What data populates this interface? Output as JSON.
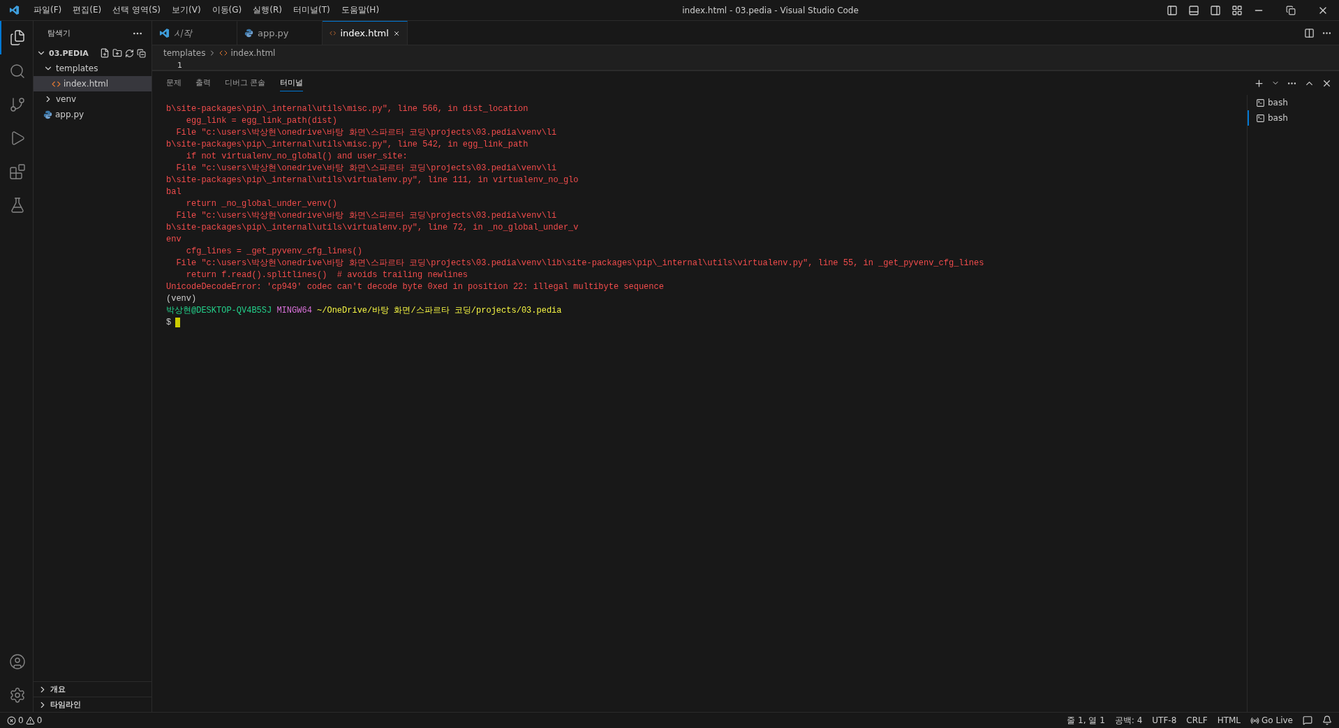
{
  "menu": [
    "파일(F)",
    "편집(E)",
    "선택 영역(S)",
    "보기(V)",
    "이동(G)",
    "실행(R)",
    "터미널(T)",
    "도움말(H)"
  ],
  "window": {
    "title": "index.html - 03.pedia - Visual Studio Code"
  },
  "activity_items": [
    {
      "kind": "explorer",
      "selected": true
    },
    {
      "kind": "search",
      "selected": false
    },
    {
      "kind": "scm",
      "selected": false
    },
    {
      "kind": "run",
      "selected": false
    },
    {
      "kind": "extensions",
      "selected": false
    },
    {
      "kind": "testing",
      "selected": false
    }
  ],
  "sidebar": {
    "title": "탐색기",
    "folder": {
      "name": "03.PEDIA",
      "expanded": true
    },
    "tree": [
      {
        "name": "templates",
        "kind": "folder",
        "expanded": true,
        "selected": false,
        "children": [
          {
            "name": "index.html",
            "kind": "html",
            "selected": true
          }
        ]
      },
      {
        "name": "venv",
        "kind": "folder",
        "expanded": false,
        "selected": false
      },
      {
        "name": "app.py",
        "kind": "python",
        "selected": false
      }
    ],
    "sections": [
      {
        "title": "개요",
        "expanded": false
      },
      {
        "title": "타임라인",
        "expanded": false
      }
    ]
  },
  "tabs": [
    {
      "label": "시작",
      "kind": "vscode",
      "preview": true,
      "selected": false
    },
    {
      "label": "app.py",
      "kind": "python",
      "preview": false,
      "selected": false
    },
    {
      "label": "index.html",
      "kind": "html",
      "preview": false,
      "selected": true
    }
  ],
  "breadcrumb": [
    "templates",
    "index.html"
  ],
  "editor": {
    "line_number": "1"
  },
  "panel_tabs": [
    {
      "label": "문제",
      "selected": false
    },
    {
      "label": "출력",
      "selected": false
    },
    {
      "label": "디버그 콘솔",
      "selected": false
    },
    {
      "label": "터미널",
      "selected": true
    }
  ],
  "terminal": {
    "lines": [
      {
        "kind": "error",
        "text": "b\\site-packages\\pip\\_internal\\utils\\misc.py\", line 566, in dist_location"
      },
      {
        "kind": "error",
        "text": "    egg_link = egg_link_path(dist)"
      },
      {
        "kind": "error",
        "text": "  File \"c:\\users\\박상현\\onedrive\\바탕 화면\\스파르타 코딩\\projects\\03.pedia\\venv\\li"
      },
      {
        "kind": "error",
        "text": "b\\site-packages\\pip\\_internal\\utils\\misc.py\", line 542, in egg_link_path"
      },
      {
        "kind": "error",
        "text": "    if not virtualenv_no_global() and user_site:"
      },
      {
        "kind": "error",
        "text": "  File \"c:\\users\\박상현\\onedrive\\바탕 화면\\스파르타 코딩\\projects\\03.pedia\\venv\\li"
      },
      {
        "kind": "error",
        "text": "b\\site-packages\\pip\\_internal\\utils\\virtualenv.py\", line 111, in virtualenv_no_glo"
      },
      {
        "kind": "error",
        "text": "bal"
      },
      {
        "kind": "error",
        "text": "    return _no_global_under_venv()"
      },
      {
        "kind": "error",
        "text": "  File \"c:\\users\\박상현\\onedrive\\바탕 화면\\스파르타 코딩\\projects\\03.pedia\\venv\\li"
      },
      {
        "kind": "error",
        "text": "b\\site-packages\\pip\\_internal\\utils\\virtualenv.py\", line 72, in _no_global_under_v"
      },
      {
        "kind": "error",
        "text": "env"
      },
      {
        "kind": "error",
        "text": "    cfg_lines = _get_pyvenv_cfg_lines()"
      },
      {
        "kind": "error",
        "text": "  File \"c:\\users\\박상현\\onedrive\\바탕 화면\\스파르타 코딩\\projects\\03.pedia\\venv\\lib\\site-packages\\pip\\_internal\\utils\\virtualenv.py\", line 55, in _get_pyvenv_cfg_lines"
      },
      {
        "kind": "error",
        "text": "    return f.read().splitlines()  # avoids trailing newlines"
      },
      {
        "kind": "error",
        "text": "UnicodeDecodeError: 'cp949' codec can't decode byte 0xed in position 22: illegal multibyte sequence"
      },
      {
        "kind": "plain",
        "text": "(venv)"
      },
      {
        "kind": "prompt",
        "user": "박상현@DESKTOP-QV4B5SJ",
        "system": "MINGW64",
        "path": "~/OneDrive/바탕 화면/스파르타 코딩/projects/03.pedia"
      },
      {
        "kind": "input",
        "text": "$"
      }
    ]
  },
  "terminal_sessions": [
    {
      "label": "bash",
      "selected": false
    },
    {
      "label": "bash",
      "selected": true
    }
  ],
  "status_bar": {
    "errors": "0",
    "warnings": "0",
    "right": [
      {
        "kind": "text",
        "text": "줄 1, 열 1"
      },
      {
        "kind": "text",
        "text": "공백: 4"
      },
      {
        "kind": "text",
        "text": "UTF-8"
      },
      {
        "kind": "text",
        "text": "CRLF"
      },
      {
        "kind": "text",
        "text": "HTML"
      },
      {
        "kind": "golive",
        "text": "Go Live"
      },
      {
        "kind": "feedback"
      },
      {
        "kind": "bell"
      }
    ]
  }
}
